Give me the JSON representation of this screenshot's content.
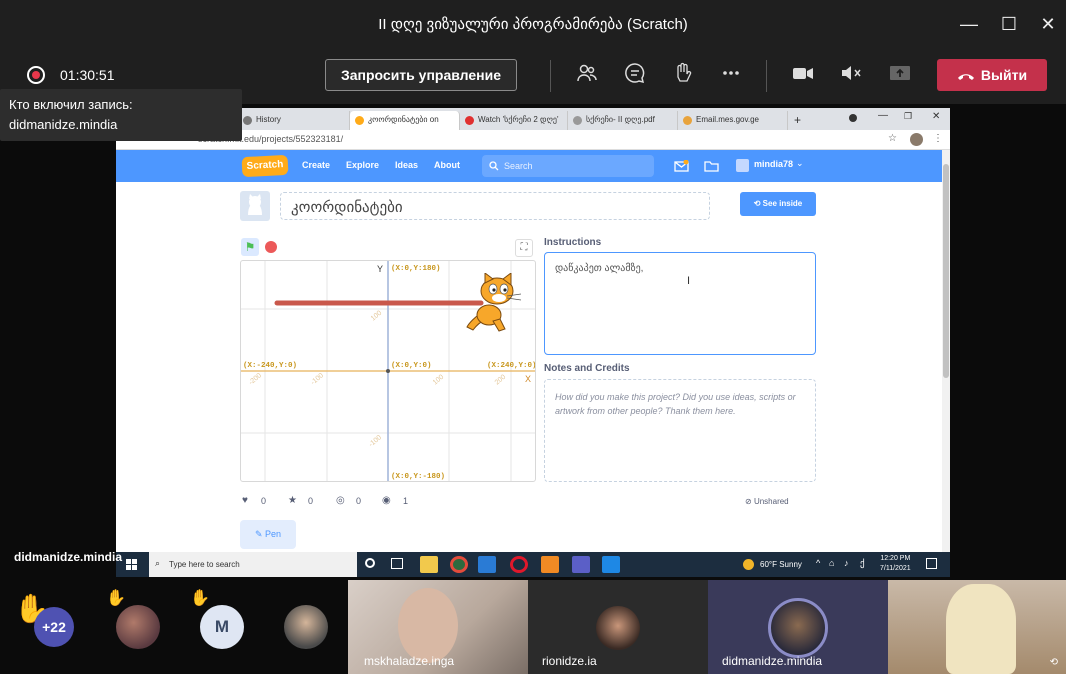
{
  "window": {
    "title": "II დღე ვიზუალური პროგრამირება (Scratch)",
    "minimize": "—",
    "maximize": "☐",
    "close": "✕"
  },
  "meeting": {
    "timer": "01:30:51",
    "request_control": "Запросить управление",
    "leave": "Выйти",
    "tooltip": {
      "line1": "Кто включил запись:",
      "line2": "didmanidze.mindia"
    }
  },
  "browser": {
    "tabs": [
      {
        "label": "History"
      },
      {
        "label": "კოორდინატები on"
      },
      {
        "label": "Watch 'სქრეჩი 2 დღე'"
      },
      {
        "label": "სქრეჩი- II დღე.pdf"
      },
      {
        "label": "Email.mes.gov.ge"
      }
    ],
    "url": "scratch.mit.edu/projects/552323181/"
  },
  "scratch": {
    "logo": "Scratch",
    "nav": [
      "Create",
      "Explore",
      "Ideas",
      "About"
    ],
    "search_placeholder": "Search",
    "user": "mindia78",
    "project_title": "კოორდინატები",
    "see_inside": "See inside",
    "instructions_label": "Instructions",
    "instructions_text": "დაწკაპეთ ალამზე,",
    "notes_label": "Notes and Credits",
    "notes_placeholder": "How did you make this project? Did you use ideas, scripts or artwork from other people? Thank them here.",
    "stats": {
      "loves": "0",
      "favorites": "0",
      "remixes": "0",
      "views": "1"
    },
    "unshared": "Unshared",
    "pen_label": "Pen",
    "stage": {
      "y_axis": "Y",
      "x_axis": "X",
      "top_label": "(X:0,Y:180)",
      "left_label": "(X:-240,Y:0)",
      "center_label": "(X:0,Y:0)",
      "right_label": "(X:240,Y:0)",
      "bottom_label": "(X:0,Y:-180)",
      "tick_top": "100",
      "tick_left_outer": "-200",
      "tick_left_inner": "-100",
      "tick_right_inner": "100",
      "tick_right_outer": "200",
      "tick_bottom": "-100"
    }
  },
  "taskbar": {
    "search": "Type here to search",
    "weather": "60°F  Sunny",
    "time": "12:20 PM",
    "date": "7/11/2021"
  },
  "speaker_label": "didmanidze.mindia",
  "participants": {
    "overflow": "+22",
    "avatar_m": "M",
    "tiles": [
      {
        "name": "mskhaladze.inga"
      },
      {
        "name": "rionidze.ia"
      },
      {
        "name": "didmanidze.mindia"
      }
    ]
  },
  "colors": {
    "accent": "#4d97ff",
    "leave": "#c4314b",
    "record": "#e8374b",
    "hand": "#f2b930",
    "pen_line": "#c9584b"
  }
}
